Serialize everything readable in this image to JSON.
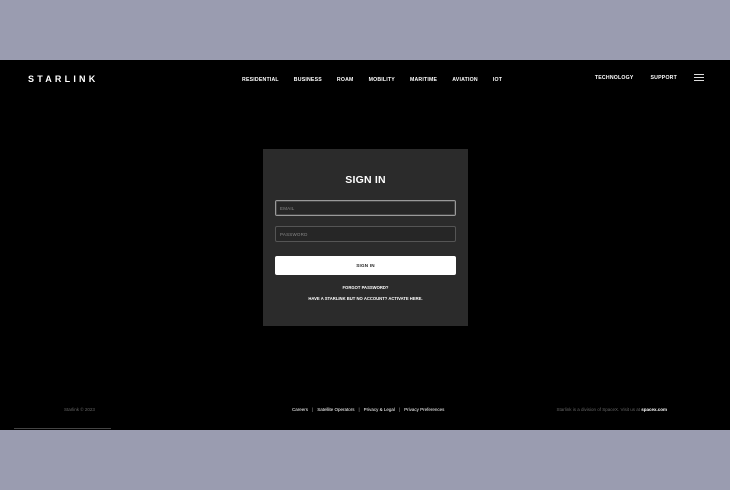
{
  "brand": {
    "logo": "STARLINK"
  },
  "nav": {
    "main_items": [
      "RESIDENTIAL",
      "BUSINESS",
      "ROAM",
      "MOBILITY",
      "MARITIME",
      "AVIATION",
      "IOT"
    ],
    "right_items": [
      "TECHNOLOGY",
      "SUPPORT"
    ],
    "menu_icon": "hamburger-menu-icon"
  },
  "signin": {
    "title": "SIGN IN",
    "email_placeholder": "EMAIL",
    "password_placeholder": "PASSWORD",
    "button_label": "SIGN IN",
    "forgot_link": "FORGOT PASSWORD?",
    "activate_link": "HAVE A STARLINK BUT NO ACCOUNT? ACTIVATE HERE."
  },
  "footer": {
    "copyright": "Starlink © 2023",
    "links": [
      "Careers",
      "Satellite Operators",
      "Privacy & Legal",
      "Privacy Preferences"
    ],
    "separator": "|",
    "division_text": "Starlink is a division of SpaceX. Visit us at",
    "division_site": "spacex.com"
  },
  "colors": {
    "page_background": "#9a9cb0",
    "window_background": "#000000",
    "card_background": "#2b2b2b",
    "button_background": "#ffffff"
  }
}
